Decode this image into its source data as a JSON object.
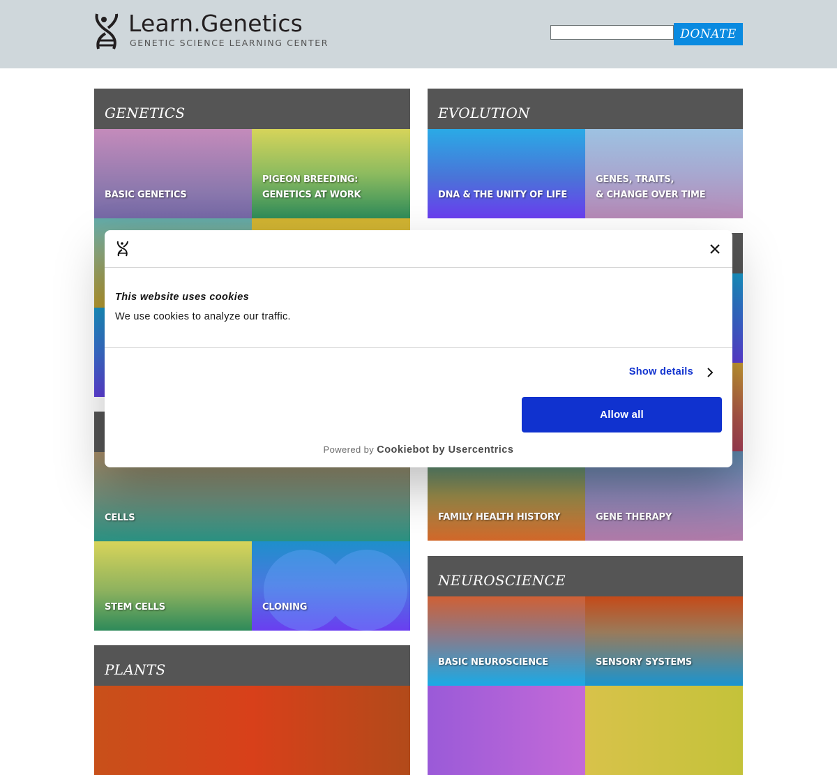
{
  "header": {
    "logo_title": "Learn.Genetics",
    "logo_subtitle": "GENETIC SCIENCE LEARNING CENTER",
    "search_value": "",
    "donate_label": "DONATE",
    "donate_color": "#0a8ae0"
  },
  "sections": {
    "genetics": {
      "title": "GENETICS",
      "tiles": [
        {
          "label": "BASIC GENETICS"
        },
        {
          "label": "PIGEON BREEDING:\nGENETICS AT WORK"
        },
        {
          "label": ""
        },
        {
          "label": ""
        },
        {
          "label": ""
        },
        {
          "label": ""
        }
      ]
    },
    "evolution": {
      "title": "EVOLUTION",
      "tiles": [
        {
          "label": "DNA & THE UNITY OF LIFE"
        },
        {
          "label": "GENES, TRAITS,\n& CHANGE OVER TIME"
        }
      ]
    },
    "cell_biology": {
      "title": "",
      "tiles": [
        {
          "label": "CELLS"
        },
        {
          "label": "STEM CELLS"
        },
        {
          "label": "CLONING"
        }
      ]
    },
    "right_hidden": {
      "title": "",
      "tiles": [
        {
          "label": ""
        },
        {
          "label": ""
        }
      ]
    },
    "human_health": {
      "title": "",
      "tiles": [
        {
          "label": "FAMILY HEALTH HISTORY"
        },
        {
          "label": "GENE THERAPY"
        }
      ]
    },
    "neuroscience": {
      "title": "NEUROSCIENCE",
      "tiles": [
        {
          "label": "BASIC NEUROSCIENCE"
        },
        {
          "label": "SENSORY SYSTEMS"
        },
        {
          "label": ""
        },
        {
          "label": ""
        }
      ]
    },
    "plants": {
      "title": "PLANTS",
      "tiles": [
        {
          "label": ""
        }
      ]
    }
  },
  "cookie_dialog": {
    "title": "This website uses cookies",
    "text": "We use cookies to analyze our traffic.",
    "show_details_label": "Show details",
    "allow_all_label": "Allow all",
    "powered_prefix": "Powered by",
    "powered_brand": "Cookiebot by Usercentrics",
    "accent_color": "#1032cf"
  }
}
